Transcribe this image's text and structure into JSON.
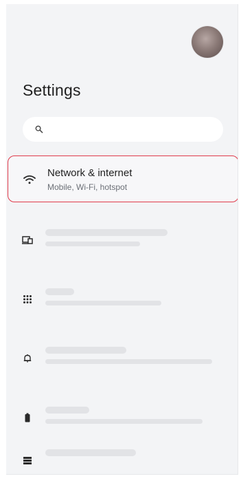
{
  "header": {
    "title": "Settings"
  },
  "search": {
    "placeholder": ""
  },
  "highlighted_item": {
    "title": "Network & internet",
    "subtitle": "Mobile, Wi-Fi, hotspot",
    "icon": "wifi-icon"
  },
  "placeholder_items": [
    {
      "icon": "devices-icon"
    },
    {
      "icon": "apps-grid-icon"
    },
    {
      "icon": "notifications-icon"
    },
    {
      "icon": "battery-icon"
    },
    {
      "icon": "storage-icon"
    }
  ],
  "colors": {
    "highlight_border": "#e03a4a",
    "panel_bg": "#f3f4f6",
    "skeleton": "#e2e3e6"
  }
}
